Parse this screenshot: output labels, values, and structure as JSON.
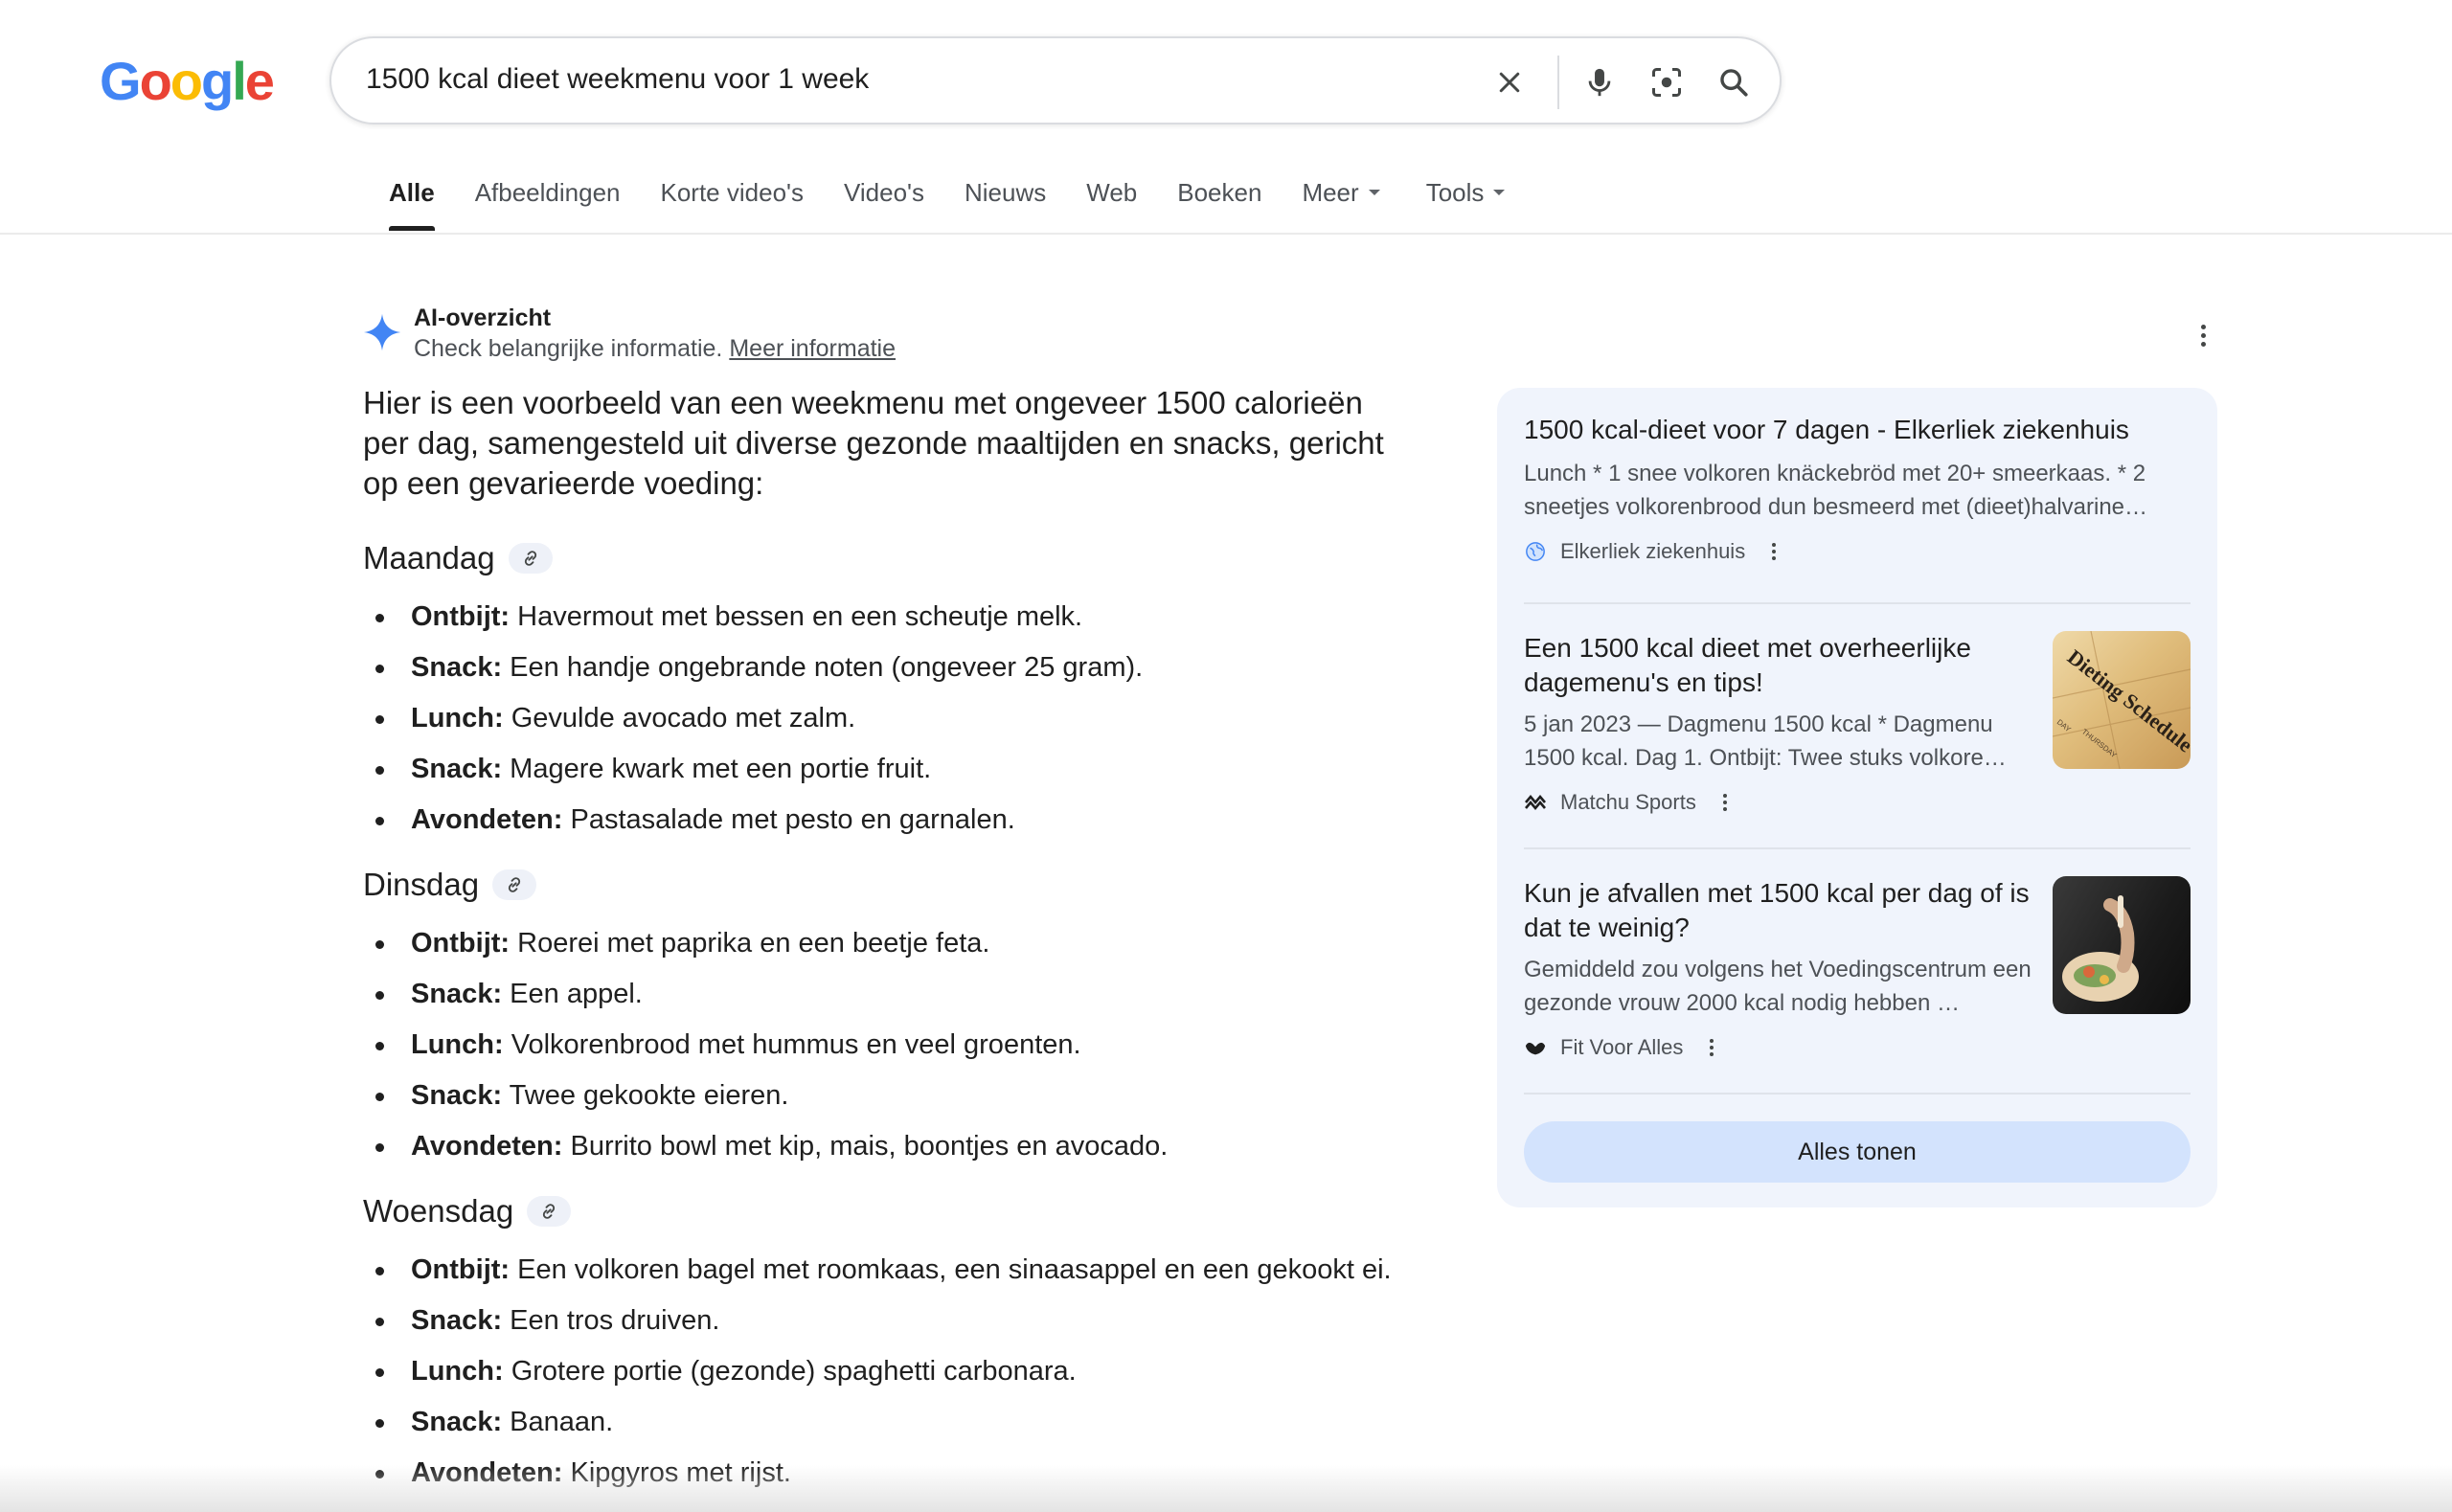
{
  "logo": {
    "letters": [
      "G",
      "o",
      "o",
      "g",
      "l",
      "e"
    ],
    "colors": [
      "#4285F4",
      "#EA4335",
      "#FBBC05",
      "#4285F4",
      "#34A853",
      "#EA4335"
    ]
  },
  "search": {
    "query": "1500 kcal dieet weekmenu voor 1 week"
  },
  "tabs": [
    {
      "label": "Alle",
      "active": true
    },
    {
      "label": "Afbeeldingen"
    },
    {
      "label": "Korte video's"
    },
    {
      "label": "Video's"
    },
    {
      "label": "Nieuws"
    },
    {
      "label": "Web"
    },
    {
      "label": "Boeken"
    },
    {
      "label": "Meer",
      "dropdown": true
    },
    {
      "label": "Tools",
      "dropdown": true
    }
  ],
  "ai_overview": {
    "title": "AI-overzicht",
    "subtitle": "Check belangrijke informatie.",
    "more_link": "Meer informatie",
    "intro": "Hier is een voorbeeld van een weekmenu met ongeveer 1500 calorieën per dag, samengesteld uit diverse gezonde maaltijden en snacks, gericht op een gevarieerde voeding:",
    "days": [
      {
        "name": "Maandag",
        "items": [
          {
            "label": "Ontbijt:",
            "text": " Havermout met bessen en een scheutje melk."
          },
          {
            "label": "Snack:",
            "text": " Een handje ongebrande noten (ongeveer 25 gram)."
          },
          {
            "label": "Lunch:",
            "text": " Gevulde avocado met zalm."
          },
          {
            "label": "Snack:",
            "text": " Magere kwark met een portie fruit."
          },
          {
            "label": "Avondeten:",
            "text": " Pastasalade met pesto en garnalen."
          }
        ]
      },
      {
        "name": "Dinsdag",
        "items": [
          {
            "label": "Ontbijt:",
            "text": " Roerei met paprika en een beetje feta."
          },
          {
            "label": "Snack:",
            "text": " Een appel."
          },
          {
            "label": "Lunch:",
            "text": " Volkorenbrood met hummus en veel groenten."
          },
          {
            "label": "Snack:",
            "text": " Twee gekookte eieren."
          },
          {
            "label": "Avondeten:",
            "text": " Burrito bowl met kip, mais, boontjes en avocado."
          }
        ]
      },
      {
        "name": "Woensdag",
        "items": [
          {
            "label": "Ontbijt:",
            "text": " Een volkoren bagel met roomkaas, een sinaasappel en een gekookt ei."
          },
          {
            "label": "Snack:",
            "text": " Een tros druiven."
          },
          {
            "label": "Lunch:",
            "text": " Grotere portie (gezonde) spaghetti carbonara."
          },
          {
            "label": "Snack:",
            "text": " Banaan."
          },
          {
            "label": "Avondeten:",
            "text": " Kipgyros met rijst."
          }
        ]
      }
    ]
  },
  "sources": [
    {
      "title": "1500 kcal-dieet voor 7 dagen - Elkerliek ziekenhuis",
      "snippet": "Lunch * 1 snee volkoren knäckebröd met 20+ smeerkaas. * 2 sneetjes volkorenbrood dun besmeerd met (dieet)halvarine…",
      "site": "Elkerliek ziekenhuis"
    },
    {
      "title": "Een 1500 kcal dieet met overheerlijke dagemenu's en tips!",
      "snippet": "5 jan 2023 — Dagmenu 1500 kcal * Dagmenu 1500 kcal. Dag 1. Ontbijt: Twee stuks volkore…",
      "site": "Matchu Sports",
      "thumb_text": "Dieting Schedule",
      "thumb_small": [
        "DAY",
        "THURSDAY"
      ]
    },
    {
      "title": "Kun je afvallen met 1500 kcal per dag of is dat te weinig?",
      "snippet": "Gemiddeld zou volgens het Voedingscentrum een gezonde vrouw 2000 kcal nodig hebben …",
      "site": "Fit Voor Alles"
    }
  ],
  "show_all_label": "Alles tonen"
}
